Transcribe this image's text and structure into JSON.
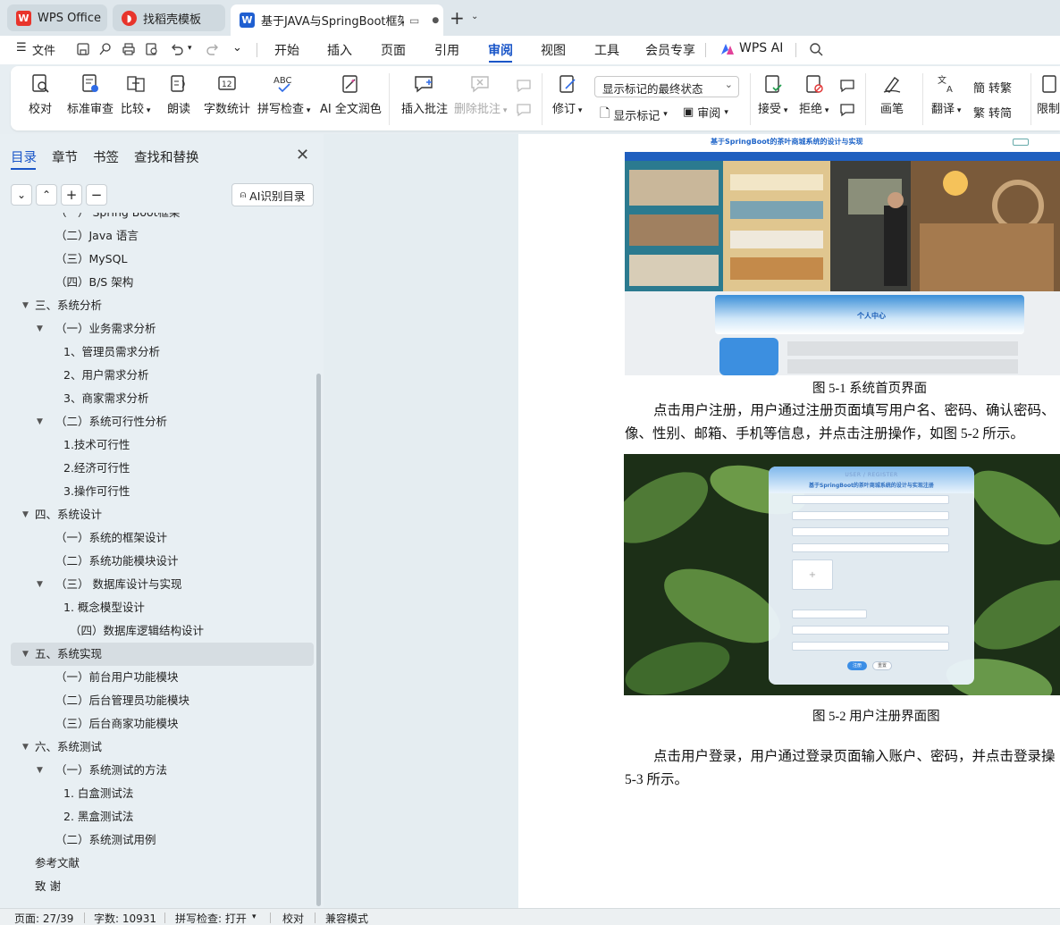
{
  "tabs": [
    {
      "label": "WPS Office",
      "icon": "wps-logo-icon"
    },
    {
      "label": "找稻壳模板",
      "icon": "daoke-icon"
    },
    {
      "label": "基于JAVA与SpringBoot框架",
      "icon": "writer-doc-icon",
      "active": true
    }
  ],
  "menubar": {
    "file": "文件",
    "items": [
      "开始",
      "插入",
      "页面",
      "引用",
      "审阅",
      "视图",
      "工具",
      "会员专享"
    ],
    "active": "审阅",
    "wps_ai": "WPS AI"
  },
  "ribbon": {
    "proofread": "校对",
    "standard_review": "标准审查",
    "compare": "比较",
    "read_aloud": "朗读",
    "word_count": "字数统计",
    "spell_check": "拼写检查",
    "ai_polish": "AI 全文润色",
    "insert_comment": "插入批注",
    "delete_comment": "删除批注",
    "track_changes": "修订",
    "display_mode": "显示标记的最终状态",
    "show_markup": "显示标记",
    "review_pane": "审阅",
    "accept": "接受",
    "reject": "拒绝",
    "pen": "画笔",
    "translate": "翻译",
    "to_traditional": "转繁",
    "to_simplified": "转简",
    "restrict": "限制"
  },
  "nav": {
    "tabs": [
      "目录",
      "章节",
      "书签",
      "查找和替换"
    ],
    "active_tab": "目录",
    "ai_toc": "AI识别目录",
    "toc": [
      {
        "text": "（一）   Spring Boot框架",
        "level": 2
      },
      {
        "text": "（二）Java 语言",
        "level": 2
      },
      {
        "text": "（三）MySQL",
        "level": 2
      },
      {
        "text": "（四）B/S 架构",
        "level": 2
      },
      {
        "text": "三、系统分析",
        "level": 1,
        "expanded": true
      },
      {
        "text": "（一）业务需求分析",
        "level": 2,
        "expanded": true
      },
      {
        "text": "1、管理员需求分析",
        "level": 3
      },
      {
        "text": "2、用户需求分析",
        "level": 3
      },
      {
        "text": "3、商家需求分析",
        "level": 3
      },
      {
        "text": "（二）系统可行性分析",
        "level": 2,
        "expanded": true
      },
      {
        "text": "1.技术可行性",
        "level": 3
      },
      {
        "text": "2.经济可行性",
        "level": 3
      },
      {
        "text": "3.操作可行性",
        "level": 3
      },
      {
        "text": "四、系统设计",
        "level": 1,
        "expanded": true
      },
      {
        "text": "（一）系统的框架设计",
        "level": 2
      },
      {
        "text": "（二）系统功能模块设计",
        "level": 2
      },
      {
        "text": "（三）  数据库设计与实现",
        "level": 2,
        "expanded": true
      },
      {
        "text": "1. 概念模型设计",
        "level": 3
      },
      {
        "text": "（四）数据库逻辑结构设计",
        "level": 3.5
      },
      {
        "text": "五、系统实现",
        "level": 1,
        "expanded": true,
        "selected": true
      },
      {
        "text": "（一）前台用户功能模块",
        "level": 2
      },
      {
        "text": "（二）后台管理员功能模块",
        "level": 2
      },
      {
        "text": "（三）后台商家功能模块",
        "level": 2
      },
      {
        "text": "六、系统测试",
        "level": 1,
        "expanded": true
      },
      {
        "text": "（一）系统测试的方法",
        "level": 2,
        "expanded": true
      },
      {
        "text": "1. 白盒测试法",
        "level": 3
      },
      {
        "text": "2. 黑盒测试法",
        "level": 3
      },
      {
        "text": "（二）系统测试用例",
        "level": 2
      },
      {
        "text": "参考文献",
        "level": 1
      },
      {
        "text": "致    谢",
        "level": 1
      }
    ]
  },
  "document": {
    "fig1_banner_title": "基于SpringBoot的茶叶商城系统的设计与实现",
    "fig1_personal_center": "个人中心",
    "caption1": "图 5-1  系统首页界面",
    "para1_line1": "点击用户注册，用户通过注册页面填写用户名、密码、确认密码、",
    "para1_line2": "像、性别、邮箱、手机等信息，并点击注册操作，如图 5-2 所示。",
    "fig2_title": "USER / REGISTER",
    "fig2_subtitle": "基于SpringBoot的茶叶商城系统的设计与实现注册",
    "fig2_register_btn": "注册",
    "fig2_reset_btn": "重置",
    "caption2": "图 5-2 用户注册界面图",
    "para2_line1": "点击用户登录，用户通过登录页面输入账户、密码，并点击登录操",
    "para2_line2": "5-3 所示。"
  },
  "statusbar": {
    "page": "页面: 27/39",
    "words": "字数: 10931",
    "spell": "拼写检查: 打开",
    "proof": "校对",
    "compat": "兼容模式"
  }
}
